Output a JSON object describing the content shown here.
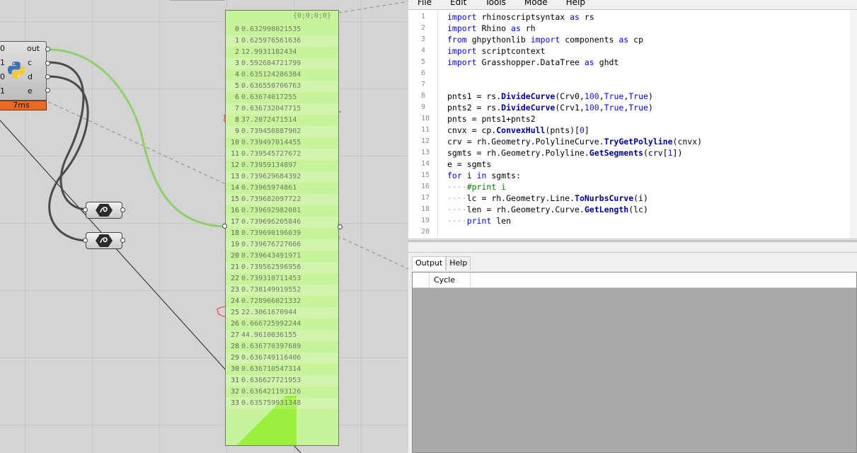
{
  "python_component": {
    "inputs": [
      "0",
      "1",
      "0",
      "1"
    ],
    "outputs": [
      "out",
      "c",
      "d",
      "e"
    ],
    "runtime": "7ms"
  },
  "panel": {
    "path": "{0;0;0;0}",
    "rows": [
      {
        "i": "0",
        "v": "0.632998021535"
      },
      {
        "i": "1",
        "v": "0.625976561636"
      },
      {
        "i": "2",
        "v": "12.9931182434"
      },
      {
        "i": "3",
        "v": "0.592684721799"
      },
      {
        "i": "4",
        "v": "0.635124286384"
      },
      {
        "i": "5",
        "v": "0.636550706763"
      },
      {
        "i": "6",
        "v": "0.63674017255"
      },
      {
        "i": "7",
        "v": "0.636732047715"
      },
      {
        "i": "8",
        "v": "37.2072471514"
      },
      {
        "i": "9",
        "v": "0.739450887902"
      },
      {
        "i": "10",
        "v": "0.739497014455"
      },
      {
        "i": "11",
        "v": "0.739545727672"
      },
      {
        "i": "12",
        "v": "0.73959134897"
      },
      {
        "i": "13",
        "v": "0.739629684392"
      },
      {
        "i": "14",
        "v": "0.73965974861"
      },
      {
        "i": "15",
        "v": "0.739682097722"
      },
      {
        "i": "16",
        "v": "0.739692982081"
      },
      {
        "i": "17",
        "v": "0.739696205846"
      },
      {
        "i": "18",
        "v": "0.739690196039"
      },
      {
        "i": "19",
        "v": "0.739676727666"
      },
      {
        "i": "20",
        "v": "0.739643491971"
      },
      {
        "i": "21",
        "v": "0.739562596956"
      },
      {
        "i": "22",
        "v": "0.739310711453"
      },
      {
        "i": "23",
        "v": "0.738149919552"
      },
      {
        "i": "24",
        "v": "0.728966021332"
      },
      {
        "i": "25",
        "v": "22.3061670944"
      },
      {
        "i": "26",
        "v": "0.666725992244"
      },
      {
        "i": "27",
        "v": "44.9610036155"
      },
      {
        "i": "28",
        "v": "0.636770397689"
      },
      {
        "i": "29",
        "v": "0.636749116406"
      },
      {
        "i": "30",
        "v": "0.636710547314"
      },
      {
        "i": "31",
        "v": "0.636627721953"
      },
      {
        "i": "32",
        "v": "0.636421193126"
      },
      {
        "i": "33",
        "v": "0.635759931348"
      }
    ],
    "highlighted_rows": [
      "8",
      "25"
    ]
  },
  "menu": [
    "File",
    "Edit",
    "Tools",
    "Mode",
    "Help"
  ],
  "editor": {
    "line_numbers": [
      "1",
      "2",
      "3",
      "4",
      "5",
      "6",
      "7",
      "8",
      "9",
      "10",
      "11",
      "12",
      "13",
      "14",
      "15",
      "16",
      "17",
      "18",
      "19",
      "20"
    ]
  },
  "output_tabs": [
    "Output",
    "Help"
  ],
  "output_column": "Cycle",
  "colors": {
    "panel_bg": "#c7f39a",
    "keyword": "#0000ff",
    "runtime_bar": "#e96b23"
  }
}
